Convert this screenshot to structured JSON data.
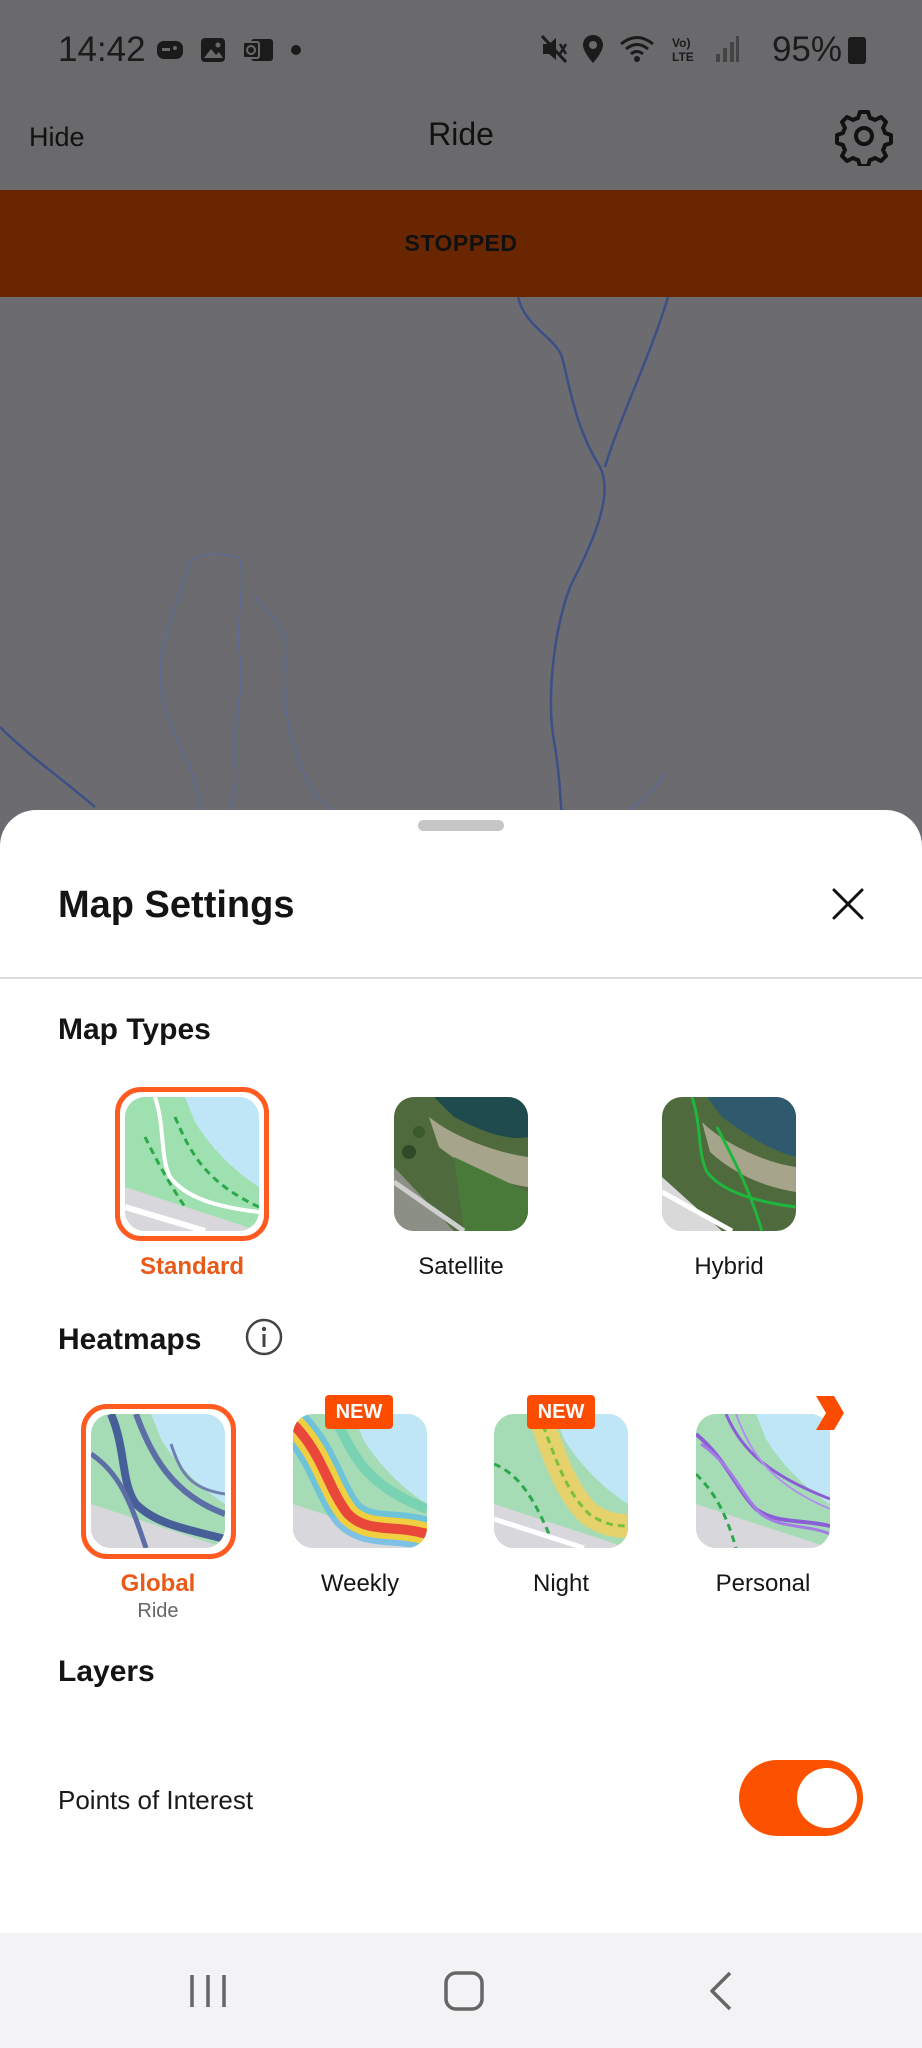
{
  "status_bar": {
    "time": "14:42",
    "battery": "95%",
    "icons_left": [
      "game-icon",
      "gallery-icon",
      "outlook-icon",
      "dot-icon"
    ],
    "icons_right": [
      "mute-icon",
      "location-icon",
      "wifi-icon",
      "volte-icon",
      "signal-icon"
    ]
  },
  "app_bar": {
    "hide_label": "Hide",
    "title": "Ride",
    "settings_icon": "gear-icon"
  },
  "banner": {
    "text": "STOPPED"
  },
  "sheet": {
    "title": "Map Settings",
    "close_icon": "close-icon",
    "map_types": {
      "heading": "Map Types",
      "items": [
        {
          "label": "Standard",
          "selected": true
        },
        {
          "label": "Satellite",
          "selected": false
        },
        {
          "label": "Hybrid",
          "selected": false
        }
      ]
    },
    "heatmaps": {
      "heading": "Heatmaps",
      "info_icon": "info-icon",
      "items": [
        {
          "label": "Global",
          "sublabel": "Ride",
          "selected": true,
          "badge": ""
        },
        {
          "label": "Weekly",
          "selected": false,
          "badge": "NEW"
        },
        {
          "label": "Night",
          "selected": false,
          "badge": "NEW"
        },
        {
          "label": "Personal",
          "selected": false,
          "badge": ""
        }
      ]
    },
    "layers": {
      "heading": "Layers",
      "points_of_interest": {
        "label": "Points of Interest",
        "enabled": true
      }
    }
  },
  "nav_bar": {
    "items": [
      "recents-icon",
      "home-icon",
      "back-icon"
    ]
  },
  "colors": {
    "accent": "#fc5200",
    "banner": "#6a2600",
    "selected_text": "#e85a17"
  }
}
